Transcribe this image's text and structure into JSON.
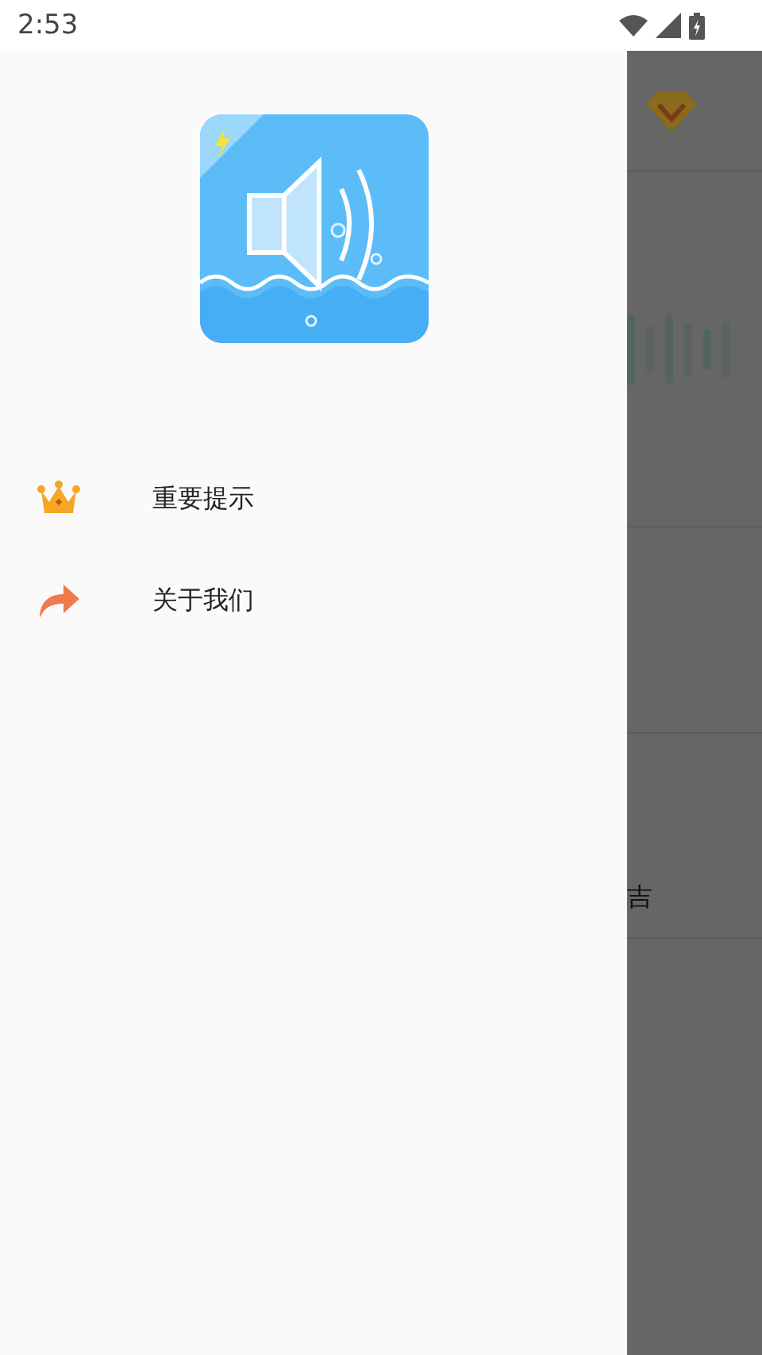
{
  "status_bar": {
    "time": "2:53"
  },
  "drawer": {
    "items": [
      {
        "kind": "crown",
        "label": "重要提示"
      },
      {
        "kind": "share",
        "label": "关于我们"
      }
    ]
  },
  "background": {
    "fragment": "吉"
  }
}
